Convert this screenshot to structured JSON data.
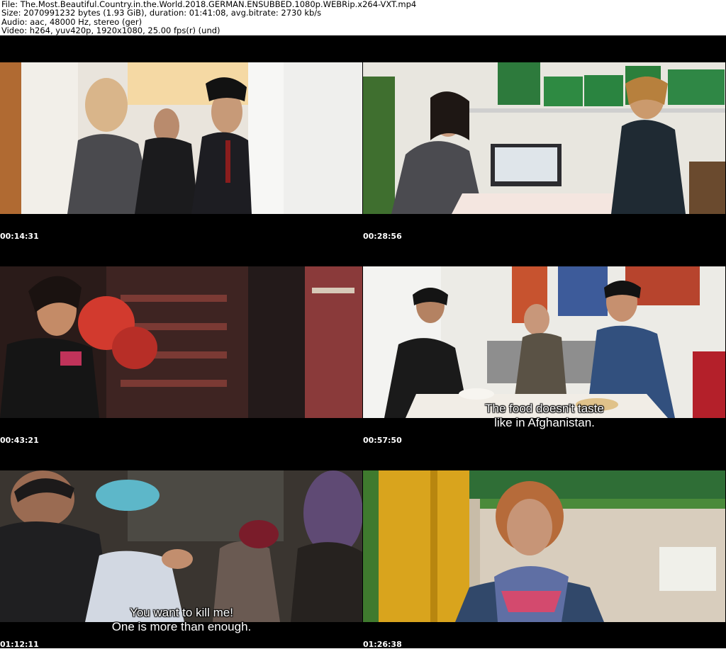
{
  "header": {
    "file_line": "File: The.Most.Beautiful.Country.in.the.World.2018.GERMAN.ENSUBBED.1080p.WEBRip.x264-VXT.mp4",
    "size_line": "Size: 2070991232 bytes (1.93 GiB), duration: 01:41:08, avg.bitrate: 2730 kb/s",
    "audio_line": "Audio: aac, 48000 Hz, stereo (ger)",
    "video_line": "Video: h264, yuv420p, 1920x1080, 25.00 fps(r) (und)"
  },
  "thumbnails": [
    {
      "timestamp": "00:14:31",
      "scene": "hallway-three-people",
      "subtitle": []
    },
    {
      "timestamp": "00:28:56",
      "scene": "laptop-conversation",
      "subtitle": []
    },
    {
      "timestamp": "00:43:21",
      "scene": "boxing-training",
      "subtitle": []
    },
    {
      "timestamp": "00:57:50",
      "scene": "dinner-on-couch",
      "subtitle": [
        "The food doesn't taste",
        "like in Afghanistan."
      ]
    },
    {
      "timestamp": "01:12:11",
      "scene": "clothes-sorting",
      "subtitle": [
        "You want to kill me!",
        "One is more than enough."
      ]
    },
    {
      "timestamp": "01:26:38",
      "scene": "woman-with-scarf",
      "subtitle": []
    }
  ],
  "colors": {
    "sheet_background": "#000000",
    "header_background": "#ffffff",
    "timestamp_text": "#ffffff"
  }
}
